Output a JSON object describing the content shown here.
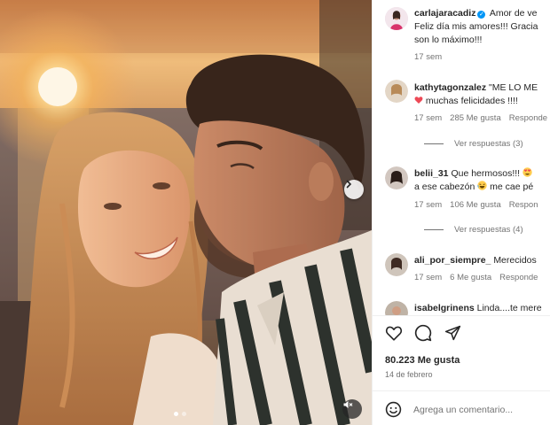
{
  "post": {
    "author": "carlajaracadiz",
    "caption_line1": "Amor de ve",
    "caption_line2": "Feliz día mis amores!!! Gracia",
    "caption_line3": "son lo máximo!!!",
    "time": "17 sem"
  },
  "comments": [
    {
      "user": "kathytagonzalez",
      "text": "\"ME LO ME",
      "text2": "muchas felicidades !!!!",
      "time": "17 sem",
      "likes": "285 Me gusta",
      "reply": "Responde",
      "view_replies": "Ver respuestas (3)",
      "emoji_icon": "heart-icon"
    },
    {
      "user": "belii_31",
      "text": "Que hermosos!!!",
      "text2": "a ese cabezón",
      "text3": "me cae pé",
      "time": "17 sem",
      "likes": "106 Me gusta",
      "reply": "Respon",
      "view_replies": "Ver respuestas (4)",
      "emoji_icon": "heart-eyes-icon"
    },
    {
      "user": "ali_por_siempre_",
      "text": "Merecidos",
      "time": "17 sem",
      "likes": "6 Me gusta",
      "reply": "Responde"
    },
    {
      "user": "isabelgrinens",
      "text": "Linda....te mere"
    }
  ],
  "stats": {
    "likes": "80.223 Me gusta",
    "date": "14 de febrero"
  },
  "input": {
    "placeholder": "Agrega un comentario..."
  },
  "colors": {
    "verified": "#0095f6",
    "heart": "#ed4956",
    "muted_text": "#737373"
  }
}
